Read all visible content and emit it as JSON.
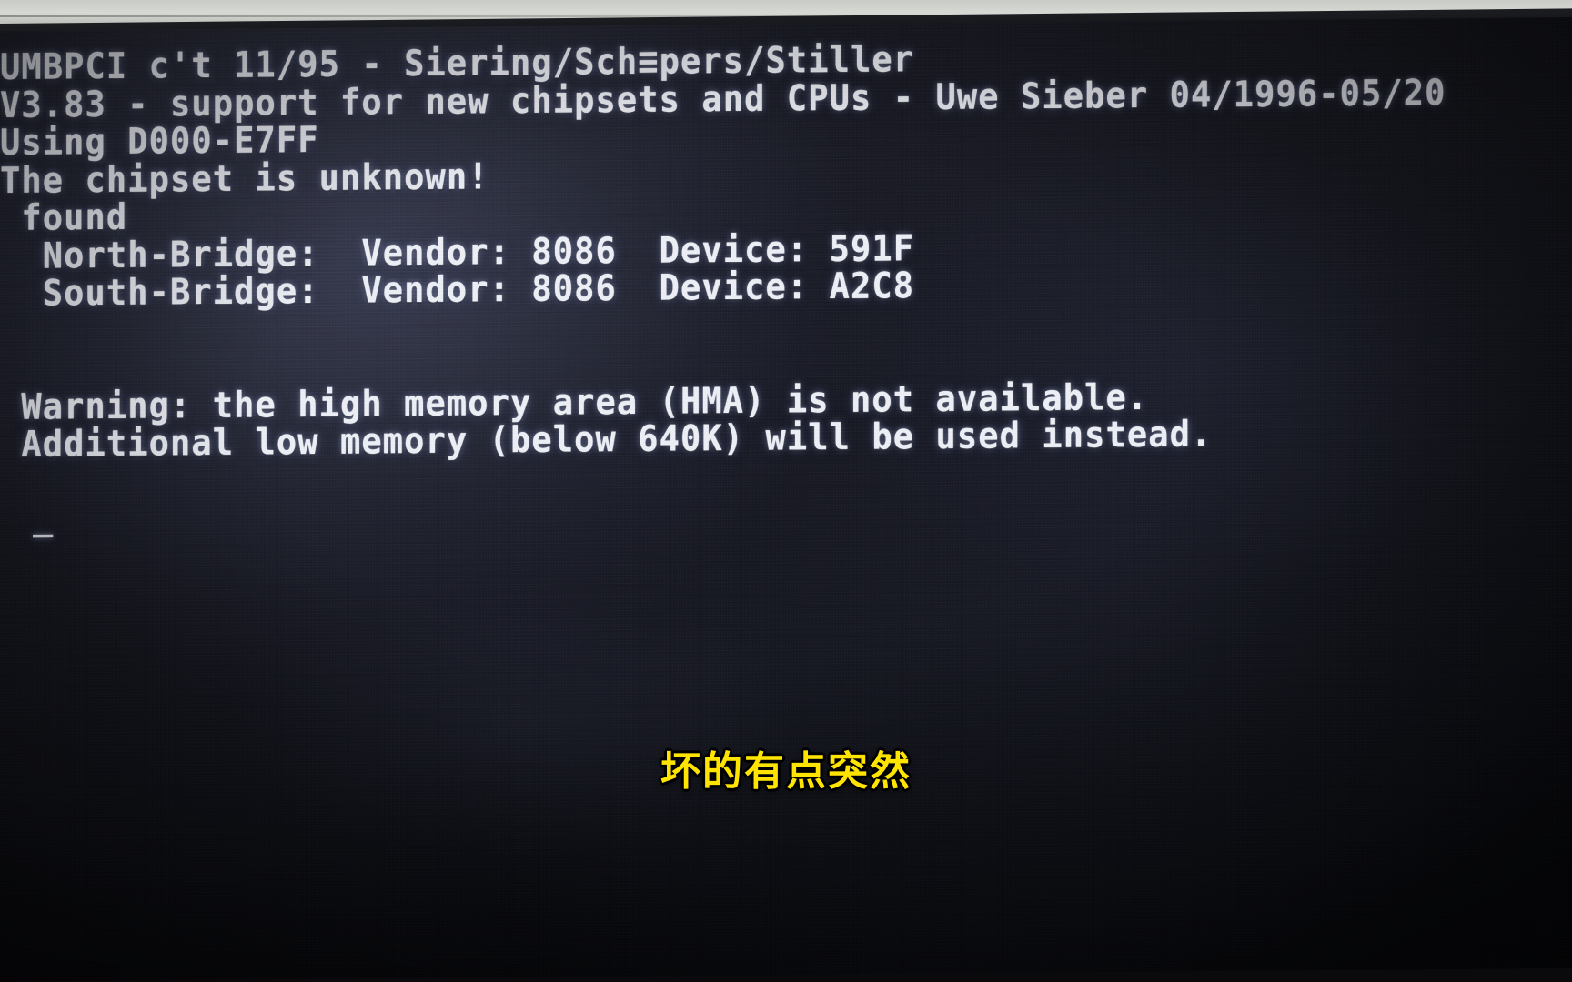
{
  "screen": {
    "kind": "dos-text-console",
    "background_color": "#0a0b10",
    "text_color": "#eceef5",
    "lines": [
      "UMBPCI c't 11/95 - Siering/Sch≡pers/Stiller",
      "V3.83 - support for new chipsets and CPUs - Uwe Sieber 04/1996-05/20",
      "Using D000-E7FF",
      "The chipset is unknown!",
      " found",
      "  North-Bridge:  Vendor: 8086  Device: 591F",
      "  South-Bridge:  Vendor: 8086  Device: A2C8",
      "",
      "",
      " Warning: the high memory area (HMA) is not available.",
      " Additional low memory (below 640K) will be used instead."
    ],
    "cursor": "_",
    "program": {
      "name": "UMBPCI",
      "source": "c't 11/95",
      "authors": "Siering/Sch≡pers/Stiller",
      "version": "V3.83",
      "version_note": "support for new chipsets and CPUs",
      "maintainer": "Uwe Sieber",
      "date_range": "04/1996-05/20",
      "umb_range": "Using D000-E7FF",
      "chipset_status": "The chipset is unknown!",
      "found_label": " found"
    },
    "bridges": [
      {
        "label": "  North-Bridge:",
        "vendor_label": "Vendor:",
        "vendor": "8086",
        "device_label": "Device:",
        "device": "591F"
      },
      {
        "label": "  South-Bridge:",
        "vendor_label": "Vendor:",
        "vendor": "8086",
        "device_label": "Device:",
        "device": "A2C8"
      }
    ],
    "warnings": [
      " Warning: the high memory area (HMA) is not available.",
      " Additional low memory (below 640K) will be used instead."
    ]
  },
  "subtitle": {
    "text": "坏的有点突然",
    "color": "#ffe400",
    "outline_color": "#000000"
  }
}
